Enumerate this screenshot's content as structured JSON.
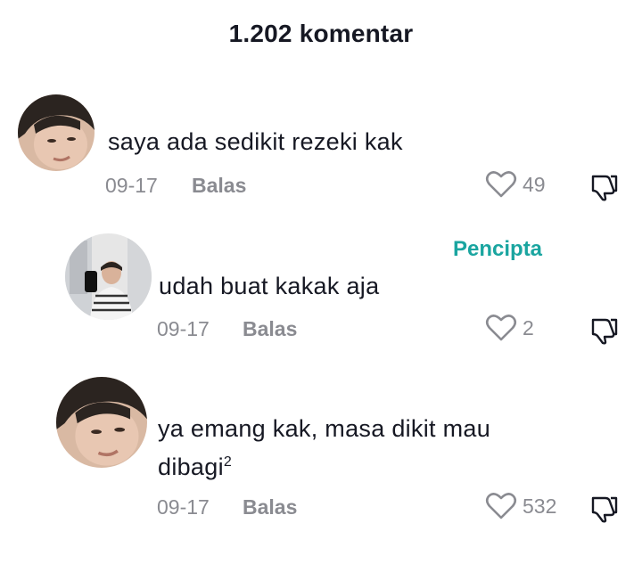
{
  "header": {
    "title": "1.202 komentar"
  },
  "comments": [
    {
      "text": "saya ada sedikit rezeki kak",
      "date": "09-17",
      "reply_label": "Balas",
      "likes": "49"
    },
    {
      "badge": "Pencipta",
      "text": "udah buat kakak aja",
      "date": "09-17",
      "reply_label": "Balas",
      "likes": "2"
    },
    {
      "text_line1": "ya emang kak, masa dikit mau",
      "text_line2": "dibagi",
      "text_sup": "2",
      "date": "09-17",
      "reply_label": "Balas",
      "likes": "532"
    }
  ],
  "icons": {
    "like": "heart-outline-icon",
    "dislike": "thumbs-down-icon"
  },
  "colors": {
    "muted": "#8a8b91",
    "creator": "#1aa5a0",
    "text": "#161823"
  }
}
